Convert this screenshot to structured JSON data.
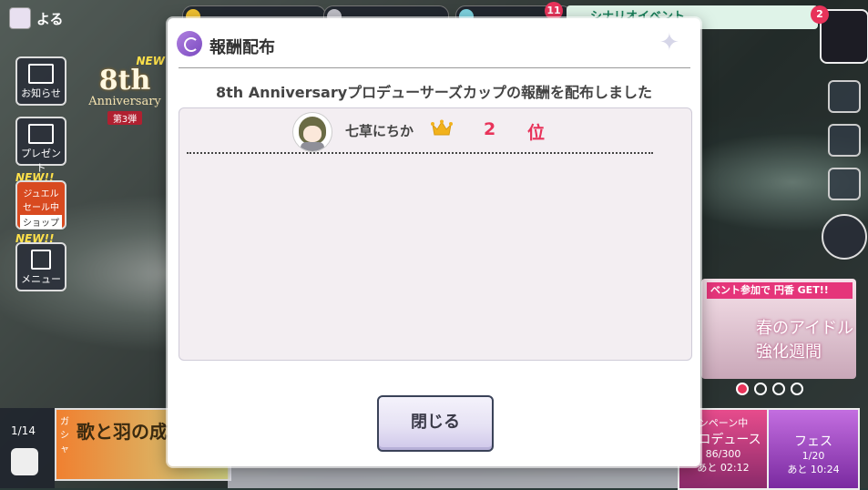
{
  "player": {
    "name": "よる"
  },
  "hud": {
    "notification_count": "11",
    "event_banner": "シナリオイベント",
    "menu_badge": "2"
  },
  "left_menu": {
    "anniversary": {
      "number": "8th",
      "word": "Anniversary",
      "new": "NEW",
      "part": "第3弾"
    },
    "news": "お知らせ",
    "present": "プレゼント",
    "shop_new": "NEW!!",
    "shop_line1": "ジュエル",
    "shop_line2": "セール中",
    "shop": "ショップ",
    "menu_new": "NEW!!",
    "menu": "メニュー"
  },
  "right_banner": {
    "label": "ベント参加で 円香 GET!!",
    "title": "春のアイドル強化週間"
  },
  "bottom": {
    "page": "1/14",
    "gacha_label": "ガシャ",
    "gacha_title": "歌と羽の成長曲線",
    "produce_label": "プロデュース",
    "produce_campaign": "ンペーン中",
    "produce_count": "86/300",
    "produce_time": "あと 02:12",
    "fes_label": "フェス",
    "fes_count": "1/20",
    "fes_time": "あと 10:24"
  },
  "dialog": {
    "title": "報酬配布",
    "message": "8th Anniversaryプロデューサーズカップの報酬を配布しました",
    "rewards": [
      {
        "idol": "七草にちか",
        "rank": "2",
        "rank_unit": "位"
      }
    ],
    "close_label": "閉じる"
  },
  "colors": {
    "rank_accent": "#e8335a",
    "crown": "#f2b21c"
  }
}
